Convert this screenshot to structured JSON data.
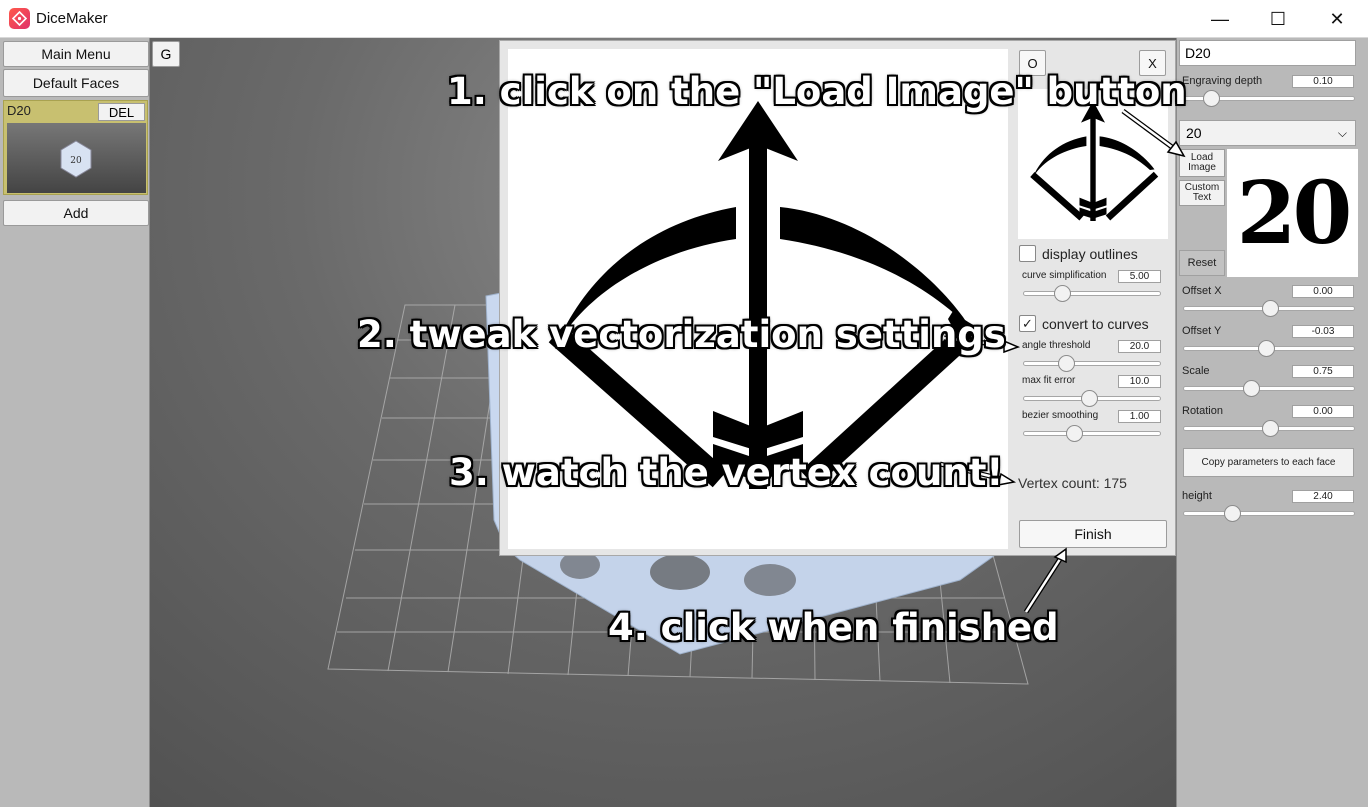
{
  "window": {
    "title": "DiceMaker",
    "minimize": "—",
    "maximize": "☐",
    "close": "✕"
  },
  "left_panel": {
    "main_menu": "Main Menu",
    "g_button": "G",
    "default_faces": "Default Faces",
    "dice_item": {
      "label": "D20",
      "delete": "DEL",
      "thumb_number": "20"
    },
    "add": "Add"
  },
  "dialog": {
    "o_button": "O",
    "close_button": "X",
    "display_outlines": {
      "label": "display outlines",
      "checked": false
    },
    "curve_simplification": {
      "label": "curve simplification",
      "value": "5.00",
      "fraction": 0.25
    },
    "convert_to_curves": {
      "label": "convert to curves",
      "checked": true,
      "check_glyph": "✓"
    },
    "angle_threshold": {
      "label": "angle threshold",
      "value": "20.0",
      "fraction": 0.28
    },
    "max_fit_error": {
      "label": "max fit error",
      "value": "10.0",
      "fraction": 0.47
    },
    "bezier_smoothing": {
      "label": "bezier smoothing",
      "value": "1.00",
      "fraction": 0.35
    },
    "vertex_count": "Vertex count: 175",
    "finish": "Finish"
  },
  "right_panel": {
    "name": "D20",
    "engraving_depth": {
      "label": "Engraving depth",
      "value": "0.10",
      "fraction": 0.12
    },
    "face_select": "20",
    "load_image": "Load Image",
    "custom_text": "Custom Text",
    "reset": "Reset",
    "face_preview_text": "20",
    "offset_x": {
      "label": "Offset X",
      "value": "0.00",
      "fraction": 0.5
    },
    "offset_y": {
      "label": "Offset Y",
      "value": "-0.03",
      "fraction": 0.48
    },
    "scale": {
      "label": "Scale",
      "value": "0.75",
      "fraction": 0.38
    },
    "rotation": {
      "label": "Rotation",
      "value": "0.00",
      "fraction": 0.5
    },
    "copy_params": "Copy parameters to each face",
    "height": {
      "label": "height",
      "value": "2.40",
      "fraction": 0.26
    }
  },
  "annotations": {
    "step1": "1. click on the \"Load Image\" button",
    "step2": "2. tweak vectorization settings",
    "step3": "3. watch the vertex count!",
    "step4": "4. click when finished"
  },
  "colors": {
    "card_highlight": "#c8c070",
    "panel_bg": "#b9b9b9",
    "dialog_bg": "#e6e6e6",
    "die_color": "#c9d8ef"
  },
  "icons": [
    "dicemaker-logo-icon",
    "chevron-down-icon",
    "bow-arrow-icon",
    "checkmark-icon"
  ]
}
